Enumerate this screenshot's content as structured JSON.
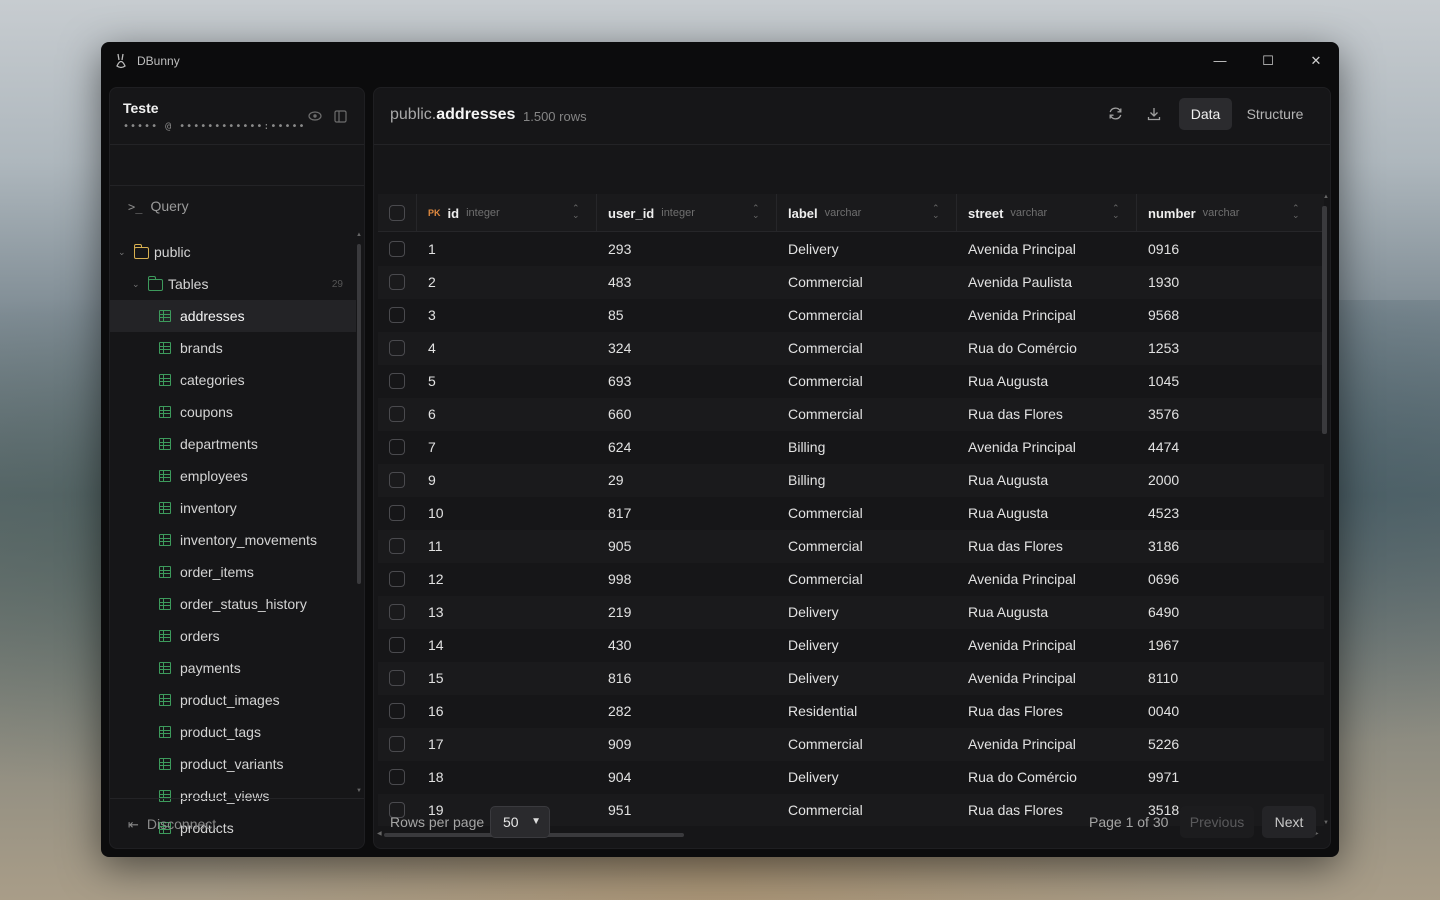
{
  "app": {
    "title": "DBunny"
  },
  "window_controls": {
    "minimize": "—",
    "maximize": "☐",
    "close": "✕"
  },
  "sidebar": {
    "connection_name": "Teste",
    "connection_masked": "••••• @ ••••••••••••:•••••",
    "query_label": "Query",
    "schema": "public",
    "tables_folder": "Tables",
    "tables_count": "29",
    "tables": [
      "addresses",
      "brands",
      "categories",
      "coupons",
      "departments",
      "employees",
      "inventory",
      "inventory_movements",
      "order_items",
      "order_status_history",
      "orders",
      "payments",
      "product_images",
      "product_tags",
      "product_variants",
      "product_views",
      "products"
    ],
    "active_table": "addresses",
    "disconnect_label": "Disconnect"
  },
  "main": {
    "schema_prefix": "public.",
    "table_name": "addresses",
    "row_count": "1.500 rows",
    "tabs": [
      "Data",
      "Structure"
    ],
    "active_tab": "Data"
  },
  "grid": {
    "columns": [
      {
        "name": "id",
        "type": "integer",
        "pk": "PK"
      },
      {
        "name": "user_id",
        "type": "integer"
      },
      {
        "name": "label",
        "type": "varchar"
      },
      {
        "name": "street",
        "type": "varchar"
      },
      {
        "name": "number",
        "type": "varchar"
      }
    ],
    "rows": [
      [
        "1",
        "293",
        "Delivery",
        "Avenida Principal",
        "0916"
      ],
      [
        "2",
        "483",
        "Commercial",
        "Avenida Paulista",
        "1930"
      ],
      [
        "3",
        "85",
        "Commercial",
        "Avenida Principal",
        "9568"
      ],
      [
        "4",
        "324",
        "Commercial",
        "Rua do Comércio",
        "1253"
      ],
      [
        "5",
        "693",
        "Commercial",
        "Rua Augusta",
        "1045"
      ],
      [
        "6",
        "660",
        "Commercial",
        "Rua das Flores",
        "3576"
      ],
      [
        "7",
        "624",
        "Billing",
        "Avenida Principal",
        "4474"
      ],
      [
        "9",
        "29",
        "Billing",
        "Rua Augusta",
        "2000"
      ],
      [
        "10",
        "817",
        "Commercial",
        "Rua Augusta",
        "4523"
      ],
      [
        "11",
        "905",
        "Commercial",
        "Rua das Flores",
        "3186"
      ],
      [
        "12",
        "998",
        "Commercial",
        "Avenida Principal",
        "0696"
      ],
      [
        "13",
        "219",
        "Delivery",
        "Rua Augusta",
        "6490"
      ],
      [
        "14",
        "430",
        "Delivery",
        "Avenida Principal",
        "1967"
      ],
      [
        "15",
        "816",
        "Delivery",
        "Avenida Principal",
        "8110"
      ],
      [
        "16",
        "282",
        "Residential",
        "Rua das Flores",
        "0040"
      ],
      [
        "17",
        "909",
        "Commercial",
        "Avenida Principal",
        "5226"
      ],
      [
        "18",
        "904",
        "Delivery",
        "Rua do Comércio",
        "9971"
      ],
      [
        "19",
        "951",
        "Commercial",
        "Rua das Flores",
        "3518"
      ]
    ]
  },
  "footer": {
    "rows_per_page_label": "Rows per page",
    "rows_per_page_value": "50",
    "page_info": "Page 1 of 30",
    "previous_label": "Previous",
    "next_label": "Next"
  },
  "colors": {
    "accent_table_icon": "#3d9a5c",
    "folder_icon": "#d8b050",
    "pk_badge": "#e08a40"
  }
}
